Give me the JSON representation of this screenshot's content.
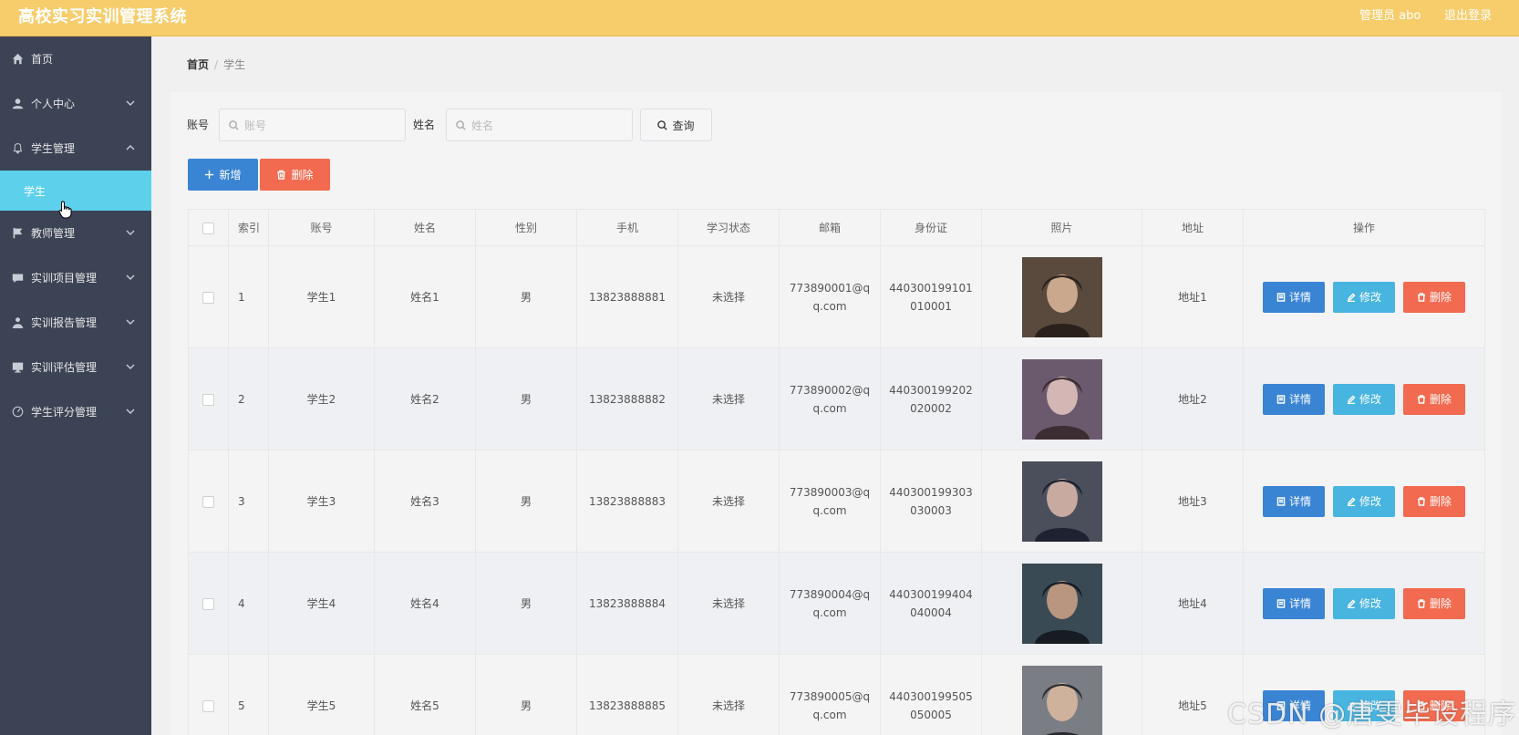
{
  "header": {
    "title": "高校实习实训管理系统",
    "user": "管理员 abo",
    "logout": "退出登录"
  },
  "sidebar": {
    "items": [
      {
        "label": "首页",
        "icon": "home-icon",
        "expandable": false
      },
      {
        "label": "个人中心",
        "icon": "user-icon",
        "expandable": true
      },
      {
        "label": "学生管理",
        "icon": "bell-icon",
        "expandable": true,
        "expanded": true
      },
      {
        "label": "教师管理",
        "icon": "flag-icon",
        "expandable": true
      },
      {
        "label": "实训项目管理",
        "icon": "chat-icon",
        "expandable": true
      },
      {
        "label": "实训报告管理",
        "icon": "person-icon",
        "expandable": true
      },
      {
        "label": "实训评估管理",
        "icon": "monitor-icon",
        "expandable": true
      },
      {
        "label": "学生评分管理",
        "icon": "gauge-icon",
        "expandable": true
      }
    ],
    "active_sub": "学生"
  },
  "breadcrumb": {
    "home": "首页",
    "separator": "/",
    "current": "学生"
  },
  "search": {
    "account_label": "账号",
    "account_placeholder": "账号",
    "name_label": "姓名",
    "name_placeholder": "姓名",
    "query_label": "查询"
  },
  "actions": {
    "add_label": "新增",
    "delete_label": "删除"
  },
  "table": {
    "headers": [
      "索引",
      "账号",
      "姓名",
      "性别",
      "手机",
      "学习状态",
      "邮箱",
      "身份证",
      "照片",
      "地址",
      "操作"
    ],
    "rows": [
      {
        "index": "1",
        "account": "学生1",
        "name": "姓名1",
        "gender": "男",
        "phone": "13823888881",
        "status": "未选择",
        "email_1": "773890001@q",
        "email_2": "q.com",
        "id_1": "440300199101",
        "id_2": "010001",
        "address": "地址1"
      },
      {
        "index": "2",
        "account": "学生2",
        "name": "姓名2",
        "gender": "男",
        "phone": "13823888882",
        "status": "未选择",
        "email_1": "773890002@q",
        "email_2": "q.com",
        "id_1": "440300199202",
        "id_2": "020002",
        "address": "地址2"
      },
      {
        "index": "3",
        "account": "学生3",
        "name": "姓名3",
        "gender": "男",
        "phone": "13823888883",
        "status": "未选择",
        "email_1": "773890003@q",
        "email_2": "q.com",
        "id_1": "440300199303",
        "id_2": "030003",
        "address": "地址3"
      },
      {
        "index": "4",
        "account": "学生4",
        "name": "姓名4",
        "gender": "男",
        "phone": "13823888884",
        "status": "未选择",
        "email_1": "773890004@q",
        "email_2": "q.com",
        "id_1": "440300199404",
        "id_2": "040004",
        "address": "地址4"
      },
      {
        "index": "5",
        "account": "学生5",
        "name": "姓名5",
        "gender": "男",
        "phone": "13823888885",
        "status": "未选择",
        "email_1": "773890005@q",
        "email_2": "q.com",
        "id_1": "440300199505",
        "id_2": "050005",
        "address": "地址5"
      }
    ],
    "ops": {
      "detail": "详情",
      "edit": "修改",
      "delete": "删除"
    }
  },
  "watermark": "CSDN @唐雯毕设程序",
  "colors": {
    "header_bg": "#f7cd6c",
    "sidebar_bg": "#3b4354",
    "active_sub_bg": "#5dd0ec",
    "add_btn": "#3a84d4",
    "delete_btn": "#f26a4f",
    "edit_btn": "#48b4e0"
  }
}
